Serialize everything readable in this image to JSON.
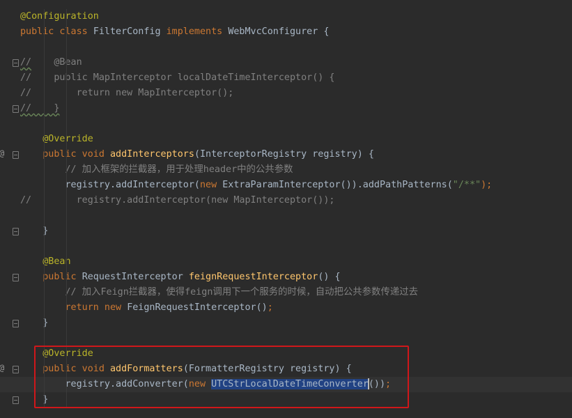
{
  "editor": {
    "lines": [
      {
        "segments": [
          {
            "t": "@Configuration",
            "c": "ann"
          }
        ]
      },
      {
        "segments": [
          {
            "t": "public class ",
            "c": "kw"
          },
          {
            "t": "FilterConfig ",
            "c": "cls"
          },
          {
            "t": "implements ",
            "c": "kw"
          },
          {
            "t": "WebMvcConfigurer {",
            "c": "cls"
          }
        ]
      },
      {
        "segments": []
      },
      {
        "segments": [
          {
            "t": "//",
            "c": "cm wavy"
          },
          {
            "t": "    @Bean",
            "c": "cm"
          }
        ]
      },
      {
        "segments": [
          {
            "t": "//    public MapInterceptor localDateTimeInterceptor() {",
            "c": "cm"
          }
        ]
      },
      {
        "segments": [
          {
            "t": "//        return new MapInterceptor();",
            "c": "cm"
          }
        ]
      },
      {
        "segments": [
          {
            "t": "//    }",
            "c": "cm wavy"
          }
        ]
      },
      {
        "segments": []
      },
      {
        "segments": [
          {
            "t": "    @Override",
            "c": "ann"
          }
        ]
      },
      {
        "segments": [
          {
            "t": "    public void ",
            "c": "kw"
          },
          {
            "t": "addInterceptors",
            "c": "fn"
          },
          {
            "t": "(InterceptorRegistry registry) {",
            "c": "cls"
          }
        ]
      },
      {
        "segments": [
          {
            "t": "        // 加入框架的拦截器，用于处理header中的公共参数",
            "c": "cm"
          }
        ]
      },
      {
        "segments": [
          {
            "t": "        registry.addInterceptor(",
            "c": "cls"
          },
          {
            "t": "new ",
            "c": "kw"
          },
          {
            "t": "ExtraParamInterceptor()).addPathPatterns(",
            "c": "cls"
          },
          {
            "t": "\"/**\"",
            "c": "str"
          },
          {
            "t": ");",
            "c": "kw"
          }
        ]
      },
      {
        "segments": [
          {
            "t": "//        registry.addInterceptor(new MapInterceptor());",
            "c": "cm"
          }
        ]
      },
      {
        "segments": []
      },
      {
        "segments": [
          {
            "t": "    }",
            "c": "cls"
          }
        ]
      },
      {
        "segments": []
      },
      {
        "segments": [
          {
            "t": "    @Bean",
            "c": "ann"
          }
        ]
      },
      {
        "segments": [
          {
            "t": "    public ",
            "c": "kw"
          },
          {
            "t": "RequestInterceptor ",
            "c": "cls"
          },
          {
            "t": "feignRequestInterceptor",
            "c": "fn"
          },
          {
            "t": "() {",
            "c": "cls"
          }
        ]
      },
      {
        "segments": [
          {
            "t": "        // 加入Feign拦截器，使得feign调用下一个服务的时候，自动把公共参数传递过去",
            "c": "cm"
          }
        ]
      },
      {
        "segments": [
          {
            "t": "        return new ",
            "c": "kw"
          },
          {
            "t": "FeignRequestInterceptor()",
            "c": "cls"
          },
          {
            "t": ";",
            "c": "kw"
          }
        ]
      },
      {
        "segments": [
          {
            "t": "    }",
            "c": "cls"
          }
        ]
      },
      {
        "segments": []
      },
      {
        "segments": [
          {
            "t": "    @Override",
            "c": "ann"
          }
        ]
      },
      {
        "segments": [
          {
            "t": "    public void ",
            "c": "kw"
          },
          {
            "t": "addFormatters",
            "c": "fn"
          },
          {
            "t": "(FormatterRegistry registry) {",
            "c": "cls"
          }
        ]
      },
      {
        "segments": [
          {
            "t": "        registry.addConverter(",
            "c": "cls"
          },
          {
            "t": "new ",
            "c": "kw"
          },
          {
            "t": "UTCStrLocalDateTimeConverte",
            "c": "cls sel"
          },
          {
            "t": "r",
            "c": "cls sel"
          },
          {
            "t": "CARET",
            "c": "caret"
          },
          {
            "t": "())",
            "c": "cls"
          },
          {
            "t": ";",
            "c": "kw"
          }
        ],
        "current": true
      },
      {
        "segments": [
          {
            "t": "    }",
            "c": "cls"
          }
        ]
      }
    ]
  },
  "gutter": {
    "fold_lines": [
      3,
      6,
      9,
      14,
      17,
      20,
      23,
      25
    ],
    "override_marks": [
      9,
      23
    ],
    "override_icon": "implement-method-icon"
  },
  "highlight": {
    "color": "#d0171a",
    "label": "annotation-box"
  }
}
